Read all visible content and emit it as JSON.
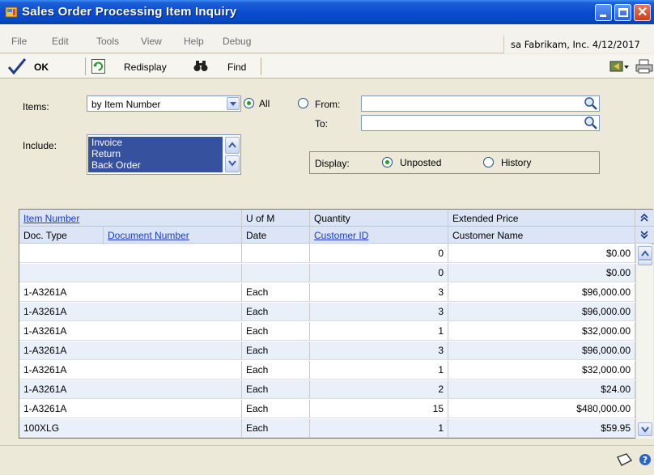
{
  "window": {
    "title": "Sales Order Processing Item Inquiry"
  },
  "menu": [
    "File",
    "Edit",
    "Tools",
    "View",
    "Help",
    "Debug"
  ],
  "company_info": "sa  Fabrikam, Inc.  4/12/2017",
  "toolbar": {
    "ok_label": "OK",
    "redisplay_label": "Redisplay",
    "find_label": "Find"
  },
  "form": {
    "items_label": "Items:",
    "items_value": "by Item Number",
    "all_label": "All",
    "from_label": "From:",
    "to_label": "To:",
    "include_label": "Include:",
    "include_options": [
      "Invoice",
      "Return",
      "Back Order"
    ],
    "display_label": "Display:",
    "unposted_label": "Unposted",
    "history_label": "History"
  },
  "grid": {
    "headers_row1": [
      "Item Number",
      "U of M",
      "Quantity",
      "Extended Price"
    ],
    "headers_row2": [
      "Doc. Type",
      "Document Number",
      "Date",
      "Customer ID",
      "Customer Name"
    ],
    "rows": [
      [
        "",
        "",
        "0",
        "$0.00"
      ],
      [
        "",
        "",
        "0",
        "$0.00"
      ],
      [
        "1-A3261A",
        "Each",
        "3",
        "$96,000.00"
      ],
      [
        "1-A3261A",
        "Each",
        "3",
        "$96,000.00"
      ],
      [
        "1-A3261A",
        "Each",
        "1",
        "$32,000.00"
      ],
      [
        "1-A3261A",
        "Each",
        "3",
        "$96,000.00"
      ],
      [
        "1-A3261A",
        "Each",
        "1",
        "$32,000.00"
      ],
      [
        "1-A3261A",
        "Each",
        "2",
        "$24.00"
      ],
      [
        "1-A3261A",
        "Each",
        "15",
        "$480,000.00"
      ],
      [
        "100XLG",
        "Each",
        "1",
        "$59.95"
      ]
    ]
  }
}
